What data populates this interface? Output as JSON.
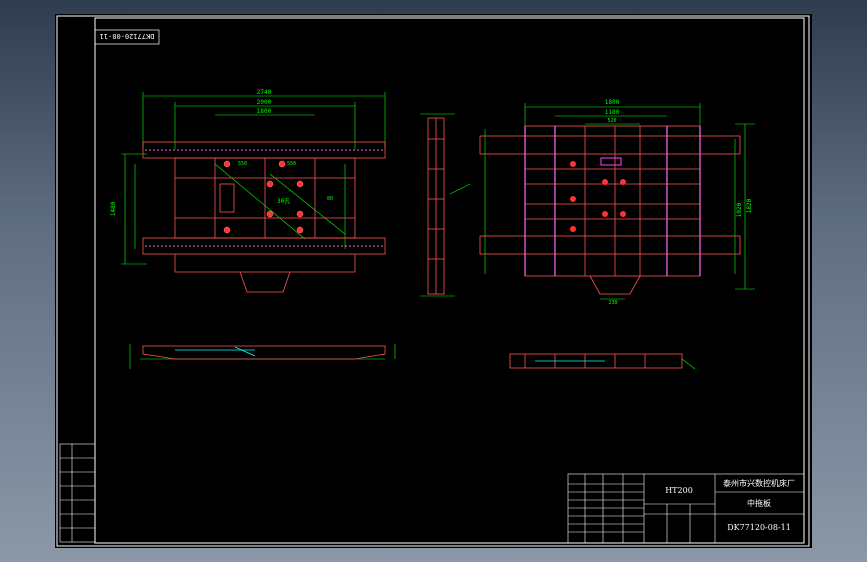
{
  "drawing": {
    "drawing_number_rotated": "DK77120-08-11",
    "material": "HT200",
    "company": "泰州市兴数控机床厂",
    "part_name": "中拖板",
    "drawing_number": "DK77120-08-11"
  },
  "dimensions": {
    "plan_view": {
      "overall_width": "2740",
      "inner_width": "2000",
      "slot_width": "1800",
      "circle_a": "550",
      "circle_b": "550",
      "hole_note": "30孔",
      "depth": "80",
      "left_height": "1480"
    },
    "right_view": {
      "width_top": "1800",
      "width_mid": "1180",
      "width_inner": "520",
      "bottom": "230",
      "height_total": "1820",
      "height_inner": "1020"
    }
  },
  "colors": {
    "frame": "#ffffff",
    "dimension": "#00ff00",
    "outline": "#ff5555",
    "hatch": "#ff66ff",
    "background": "#000000"
  }
}
